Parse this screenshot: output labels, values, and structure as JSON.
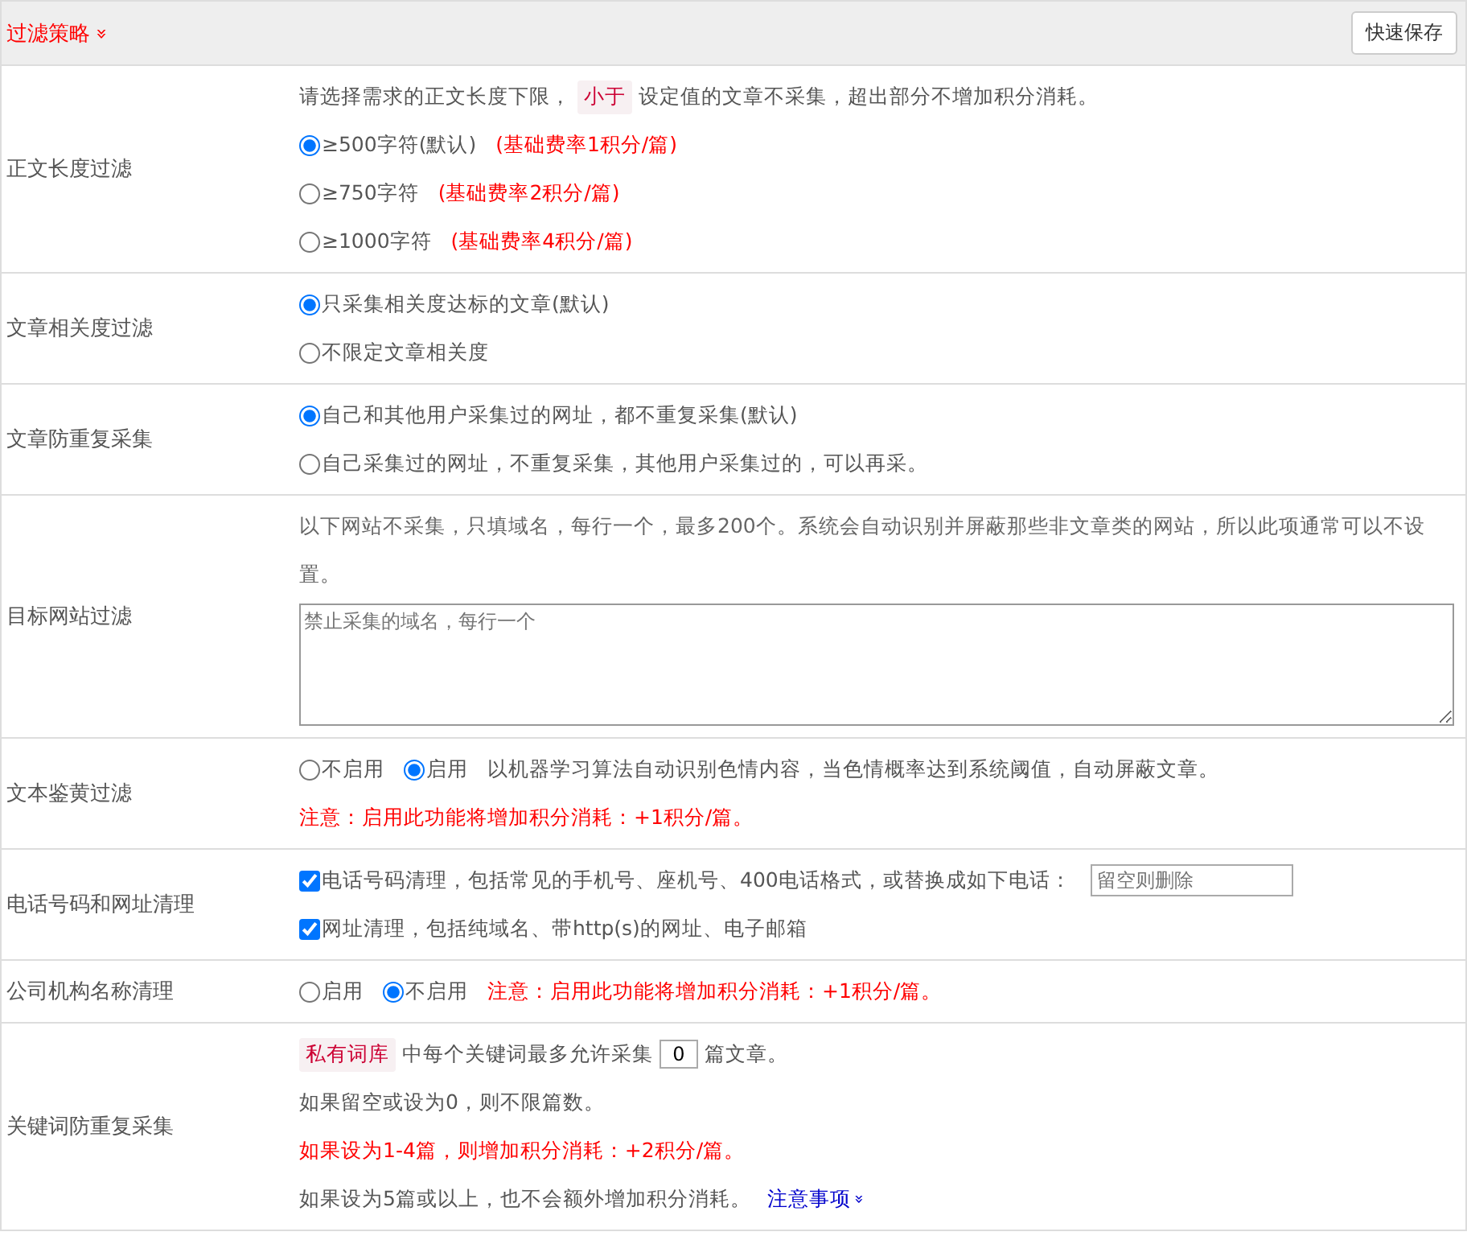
{
  "header": {
    "title": "过滤策略",
    "toggle": "»",
    "save_button": "快速保存"
  },
  "sections": [
    {
      "label": "正文长度过滤",
      "lines": [
        [
          {
            "kind": "text",
            "text": "请选择需求的正文长度下限，"
          },
          {
            "kind": "tag",
            "text": "小于"
          },
          {
            "kind": "text",
            "text": "设定值的文章不采集，超出部分不增加积分消耗。"
          }
        ],
        [
          {
            "kind": "radio",
            "text": "≥500字符(默认)",
            "selected": true
          },
          {
            "kind": "note",
            "text": "(基础费率1积分/篇)"
          }
        ],
        [
          {
            "kind": "radio",
            "text": "≥750字符",
            "selected": false
          },
          {
            "kind": "note",
            "text": "(基础费率2积分/篇)"
          }
        ],
        [
          {
            "kind": "radio",
            "text": "≥1000字符",
            "selected": false
          },
          {
            "kind": "note",
            "text": "(基础费率4积分/篇)"
          }
        ]
      ]
    },
    {
      "label": "文章相关度过滤",
      "lines": [
        [
          {
            "kind": "radio",
            "text": "只采集相关度达标的文章(默认)",
            "selected": true
          }
        ],
        [
          {
            "kind": "radio",
            "text": "不限定文章相关度",
            "selected": false
          }
        ]
      ]
    },
    {
      "label": "文章防重复采集",
      "lines": [
        [
          {
            "kind": "radio",
            "text": "自己和其他用户采集过的网址，都不重复采集(默认)",
            "selected": true
          }
        ],
        [
          {
            "kind": "radio",
            "text": "自己采集过的网址，不重复采集，其他用户采集过的，可以再采。",
            "selected": false
          }
        ]
      ]
    },
    {
      "label": "目标网站过滤",
      "lines": [
        [
          {
            "kind": "hint",
            "text": "以下网站不采集，只填域名，每行一个，最多200个。系统会自动识别并屏蔽那些非文章类的网站，所以此项通常可以不设置。"
          }
        ],
        [
          {
            "kind": "textarea",
            "placeholder": "禁止采集的域名，每行一个"
          }
        ]
      ]
    },
    {
      "label": "文本鉴黄过滤",
      "lines": [
        [
          {
            "kind": "radio",
            "text": "不启用",
            "selected": false
          },
          {
            "kind": "radio",
            "text": "启用",
            "selected": true
          },
          {
            "kind": "text",
            "text": "以机器学习算法自动识别色情内容，当色情概率达到系统阈值，自动屏蔽文章。"
          }
        ],
        [
          {
            "kind": "note",
            "text": "注意：启用此功能将增加积分消耗：+1积分/篇。"
          }
        ]
      ]
    },
    {
      "label": "电话号码和网址清理",
      "lines": [
        [
          {
            "kind": "checkbox",
            "text": "电话号码清理，包括常见的手机号、座机号、400电话格式，或替换成如下电话：",
            "checked": true
          },
          {
            "kind": "input",
            "placeholder": "留空则删除"
          }
        ],
        [
          {
            "kind": "checkbox",
            "text": "网址清理，包括纯域名、带http(s)的网址、电子邮箱",
            "checked": true
          }
        ]
      ]
    },
    {
      "label": "公司机构名称清理",
      "lines": [
        [
          {
            "kind": "radio",
            "text": "启用",
            "selected": false
          },
          {
            "kind": "radio",
            "text": "不启用",
            "selected": true
          },
          {
            "kind": "note",
            "text": "注意：启用此功能将增加积分消耗：+1积分/篇。"
          }
        ]
      ]
    },
    {
      "label": "关键词防重复采集",
      "lines": [
        [
          {
            "kind": "tag",
            "text": "私有词库"
          },
          {
            "kind": "text",
            "text": "中每个关键词最多允许采集"
          },
          {
            "kind": "number",
            "value": "0"
          },
          {
            "kind": "text",
            "text": "篇文章。"
          }
        ],
        [
          {
            "kind": "text",
            "text": "如果留空或设为0，则不限篇数。"
          }
        ],
        [
          {
            "kind": "note",
            "text": "如果设为1-4篇，则增加积分消耗：+2积分/篇。"
          }
        ],
        [
          {
            "kind": "text",
            "text": "如果设为5篇或以上，也不会额外增加积分消耗。"
          },
          {
            "kind": "link",
            "text": "注意事项",
            "toggle": "»"
          }
        ]
      ]
    }
  ]
}
